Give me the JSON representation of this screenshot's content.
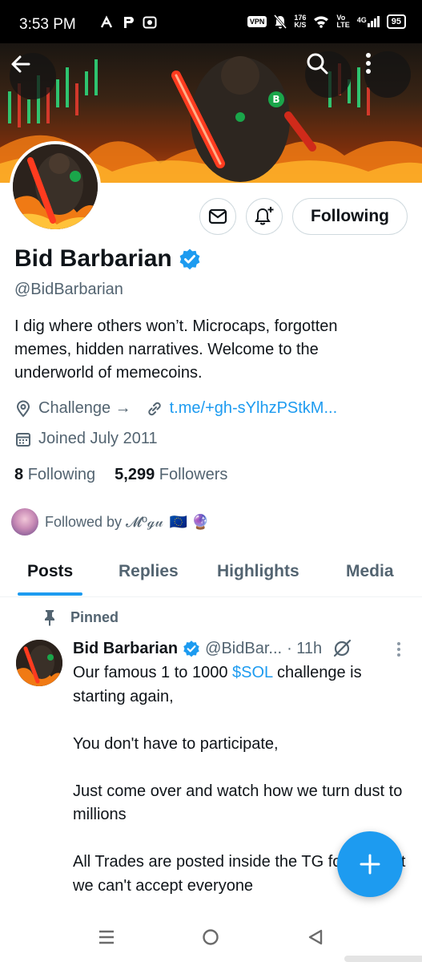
{
  "status_bar": {
    "time": "3:53 PM",
    "vpn": "VPN",
    "net_speed_value": "176",
    "net_speed_unit": "K/S",
    "volte_top": "Vo",
    "volte_bottom": "LTE",
    "network": "4G",
    "battery": "95"
  },
  "profile": {
    "display_name": "Bid Barbarian",
    "handle": "@BidBarbarian",
    "bio": "I dig where others won’t. Microcaps, forgotten memes, hidden narratives. Welcome to the underworld of memecoins.",
    "location": "Challenge →",
    "link": "t.me/+gh-sYlhzPStkM...",
    "joined": "Joined July 2011",
    "following_count": "8",
    "following_label": "Following",
    "followers_count": "5,299",
    "followers_label": "Followers",
    "followed_by": "Followed by 𝓜ºℊ𝓊",
    "followed_by_emoji": "🇪🇺 🔮"
  },
  "actions": {
    "follow_state": "Following"
  },
  "tabs": [
    {
      "label": "Posts"
    },
    {
      "label": "Replies"
    },
    {
      "label": "Highlights"
    },
    {
      "label": "Media"
    }
  ],
  "pinned_post": {
    "pinned_label": "Pinned",
    "author": "Bid Barbarian",
    "handle": "@BidBar...",
    "time": "· 11h",
    "text_line1_prefix": "Our famous 1 to 1000 ",
    "cashtag": "$SOL",
    "text_line1_suffix": " challenge is starting again,",
    "text_para2": "You don't have to participate,",
    "text_para3": "Just come over and watch how we turn dust to millions",
    "text_para4": "All Trades are posted inside the TG for free but we can't accept everyone"
  },
  "colors": {
    "accent": "#1d9bf0",
    "muted": "#536471",
    "text": "#0f1419"
  },
  "icons": {
    "back": "back-arrow-icon",
    "search": "search-icon",
    "more": "more-vertical-icon",
    "message": "envelope-icon",
    "notify": "bell-plus-icon",
    "location": "location-pin-icon",
    "link": "link-icon",
    "calendar": "calendar-icon",
    "verified": "verified-badge-icon",
    "pin": "pin-icon",
    "grok": "grok-icon",
    "compose": "plus-icon",
    "nav_recents": "menu-lines-icon",
    "nav_home": "circle-home-icon",
    "nav_back": "triangle-back-icon"
  }
}
